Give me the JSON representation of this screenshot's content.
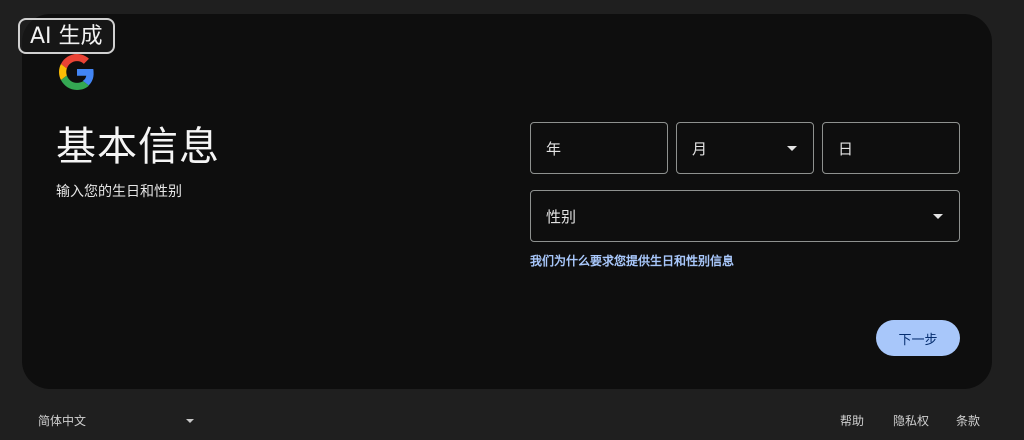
{
  "badge": {
    "label": "AI 生成"
  },
  "brand": {
    "logo_icon": "google-g-icon",
    "colors": [
      "#4285F4",
      "#EA4335",
      "#FBBC05",
      "#34A853"
    ]
  },
  "page": {
    "title": "基本信息",
    "subtitle": "输入您的生日和性别"
  },
  "form": {
    "year_placeholder": "年",
    "month_placeholder": "月",
    "day_placeholder": "日",
    "gender_placeholder": "性别",
    "why_link": "我们为什么要求您提供生日和性别信息",
    "next_label": "下一步"
  },
  "footer": {
    "language": "简体中文",
    "help": "帮助",
    "privacy": "隐私权",
    "terms": "条款"
  },
  "theme": {
    "accent": "#a8c7fa",
    "card_bg": "#0e0e0e",
    "page_bg": "#1f1f1f"
  }
}
